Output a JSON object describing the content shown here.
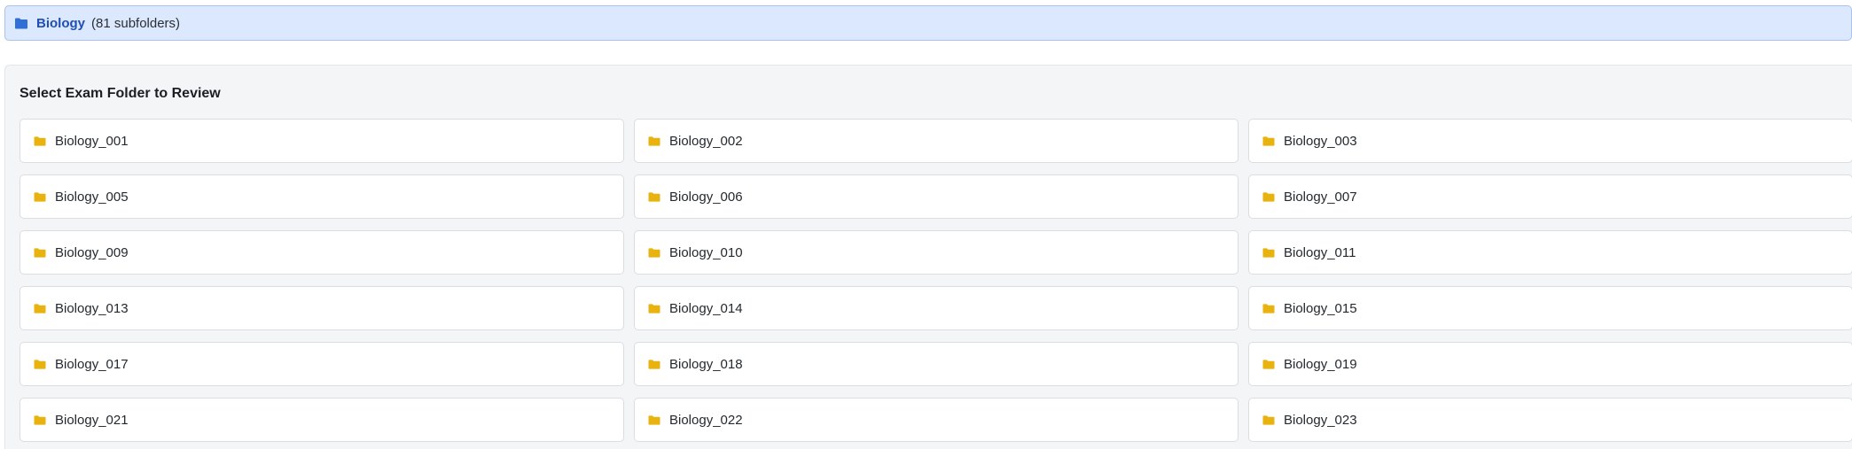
{
  "breadcrumb": {
    "icon": "folder-icon",
    "icon_color": "#2f6fd6",
    "folder_name": "Biology",
    "subfolder_count": "(81 subfolders)"
  },
  "panel": {
    "title": "Select Exam Folder to Review"
  },
  "folder_icon_color": "#e8b20f",
  "folders": [
    {
      "label": "Biology_001"
    },
    {
      "label": "Biology_002"
    },
    {
      "label": "Biology_003"
    },
    {
      "label": "Biology_005"
    },
    {
      "label": "Biology_006"
    },
    {
      "label": "Biology_007"
    },
    {
      "label": "Biology_009"
    },
    {
      "label": "Biology_010"
    },
    {
      "label": "Biology_011"
    },
    {
      "label": "Biology_013"
    },
    {
      "label": "Biology_014"
    },
    {
      "label": "Biology_015"
    },
    {
      "label": "Biology_017"
    },
    {
      "label": "Biology_018"
    },
    {
      "label": "Biology_019"
    },
    {
      "label": "Biology_021"
    },
    {
      "label": "Biology_022"
    },
    {
      "label": "Biology_023"
    }
  ]
}
